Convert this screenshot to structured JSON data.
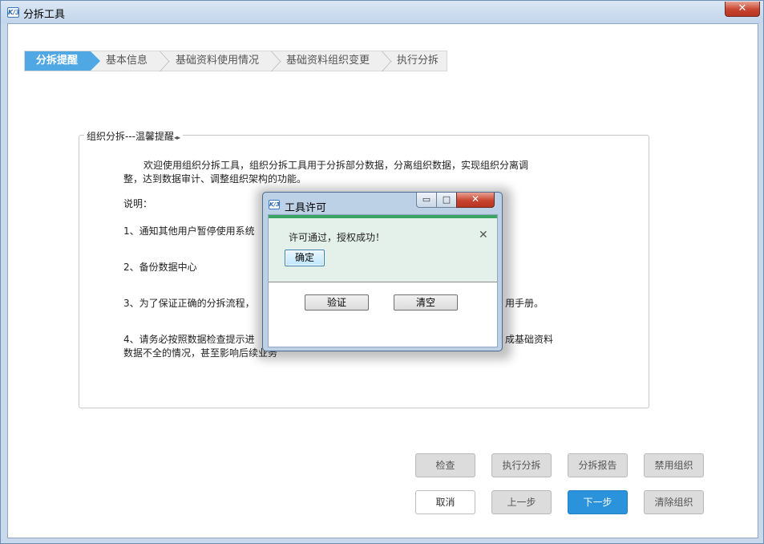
{
  "window": {
    "icon_text": "K/3",
    "title": "分拆工具",
    "close_glyph": "✕"
  },
  "steps": [
    {
      "label": "分拆提醒",
      "active": true
    },
    {
      "label": "基本信息",
      "active": false
    },
    {
      "label": "基础资料使用情况",
      "active": false
    },
    {
      "label": "基础资料组织变更",
      "active": false
    },
    {
      "label": "执行分拆",
      "active": false
    }
  ],
  "group": {
    "legend": "组织分拆---温馨提醒",
    "legend_arrow": "◂▸",
    "intro_line1": "欢迎使用组织分拆工具，组织分拆工具用于分拆部分数据，分离组织数据，实现组织分离调",
    "intro_line2": "整，达到数据审计、调整组织架构的功能。",
    "note_title": "说明：",
    "item1": "1、通知其他用户暂停使用系统",
    "item2": "2、备份数据中心",
    "item3_start": "3、为了保证正确的分拆流程，",
    "item3_end": "用手册。",
    "item4_start": "4、请务必按照数据检查提示进",
    "item4_end": "成基础资料",
    "item4_line2": "数据不全的情况，甚至影响后续业务"
  },
  "buttons": {
    "check": "检查",
    "execute_split": "执行分拆",
    "split_report": "分拆报告",
    "disable_org": "禁用组织",
    "cancel": "取消",
    "prev": "上一步",
    "next": "下一步",
    "clear_org": "清除组织"
  },
  "dialog": {
    "icon_text": "K/3",
    "title": "工具许可",
    "minimize_glyph": "▭",
    "maximize_glyph": "□",
    "close_glyph": "✕",
    "notice_message": "许可通过，授权成功！",
    "notice_close_glyph": "✕",
    "notice_ok": "确定",
    "verify": "验证",
    "clear": "清空"
  },
  "colors": {
    "step_active": "#4fa7e3",
    "primary_button": "#2b93dc",
    "notice_bar": "#3aa462",
    "notice_bg": "#e4f1ea"
  }
}
